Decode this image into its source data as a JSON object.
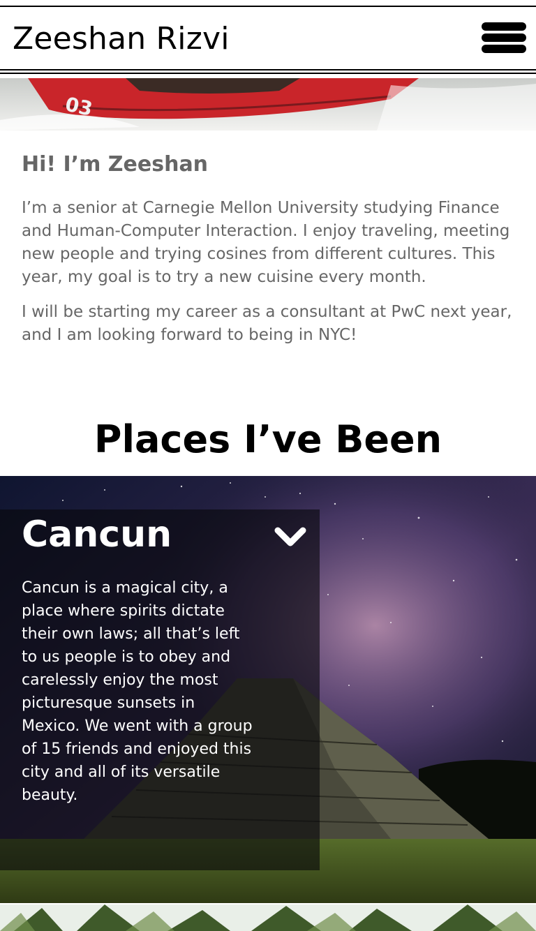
{
  "header": {
    "title": "Zeeshan Rizvi",
    "menu_icon": "hamburger-menu-icon"
  },
  "intro": {
    "heading": "Hi! I’m Zeeshan",
    "paragraphs": [
      "I’m a senior at Carnegie Mellon University studying Finance and Human-Computer Interaction. I enjoy traveling, meeting new people and trying cosines from different cultures. This year, my goal is to try a new cuisine every month.",
      "I will be starting my career as a consultant at PwC next year, and I am looking forward to being in NYC!"
    ]
  },
  "places": {
    "section_title": "Places I’ve Been",
    "items": [
      {
        "name": "Cancun",
        "toggle_icon": "chevron-down-icon",
        "description": "Cancun is a magical city, a place where spirits dictate their own laws; all that’s left to us people is to obey and carelessly enjoy the most picturesque sunsets in Mexico. We went with a group of 15 friends and enjoyed this city and all of its versatile beauty."
      }
    ]
  },
  "colors": {
    "text_gray": "#666666",
    "black": "#000000",
    "white": "#ffffff"
  }
}
